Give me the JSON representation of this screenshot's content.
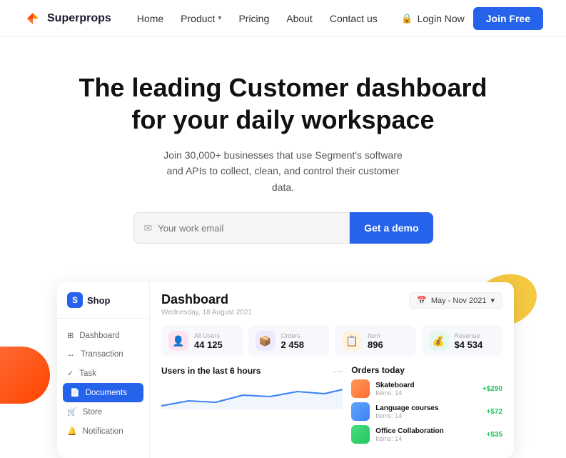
{
  "nav": {
    "logo_text": "Superprops",
    "links": [
      {
        "label": "Home",
        "has_dropdown": false
      },
      {
        "label": "Product",
        "has_dropdown": true
      },
      {
        "label": "Pricing",
        "has_dropdown": false
      },
      {
        "label": "About",
        "has_dropdown": false
      },
      {
        "label": "Contact us",
        "has_dropdown": false
      }
    ],
    "login_label": "Login Now",
    "join_label": "Join Free"
  },
  "hero": {
    "headline_line1": "The leading Customer dashboard",
    "headline_line2": "for your daily workspace",
    "subtext": "Join 30,000+ businesses that use Segment's software and APIs to collect, clean, and control their customer data.",
    "email_placeholder": "Your work email",
    "cta_label": "Get a demo"
  },
  "dashboard": {
    "sidebar": {
      "shop_name": "Shop",
      "items": [
        {
          "label": "Dashboard",
          "active": false,
          "icon": "⊞"
        },
        {
          "label": "Transaction",
          "active": false,
          "icon": "↔"
        },
        {
          "label": "Task",
          "active": false,
          "icon": "✓"
        },
        {
          "label": "Documents",
          "active": true,
          "icon": "📄"
        },
        {
          "label": "Store",
          "active": false,
          "icon": "🛒"
        },
        {
          "label": "Notification",
          "active": false,
          "icon": "🔔"
        }
      ]
    },
    "header": {
      "title": "Dashboard",
      "date": "Wednesday, 18 August 2021",
      "date_filter": "May - Nov 2021"
    },
    "stats": [
      {
        "label": "All Users",
        "value": "44 125",
        "icon": "👤",
        "color": "pink"
      },
      {
        "label": "Orders",
        "value": "2 458",
        "icon": "📦",
        "color": "purple"
      },
      {
        "label": "Item",
        "value": "896",
        "icon": "📋",
        "color": "orange"
      },
      {
        "label": "Revenue",
        "value": "$4 534",
        "icon": "💰",
        "color": "green"
      }
    ],
    "users_section": {
      "title": "Users in the last 6 hours"
    },
    "orders_section": {
      "title": "Orders today",
      "items": [
        {
          "name": "Skateboard",
          "meta": "Items: 14",
          "amount": "+$290",
          "positive": true
        },
        {
          "name": "Language courses",
          "meta": "Items: 14",
          "amount": "+$72",
          "positive": true
        },
        {
          "name": "Office Collaboration",
          "meta": "Items: 14",
          "amount": "+$35",
          "positive": true
        }
      ]
    }
  }
}
